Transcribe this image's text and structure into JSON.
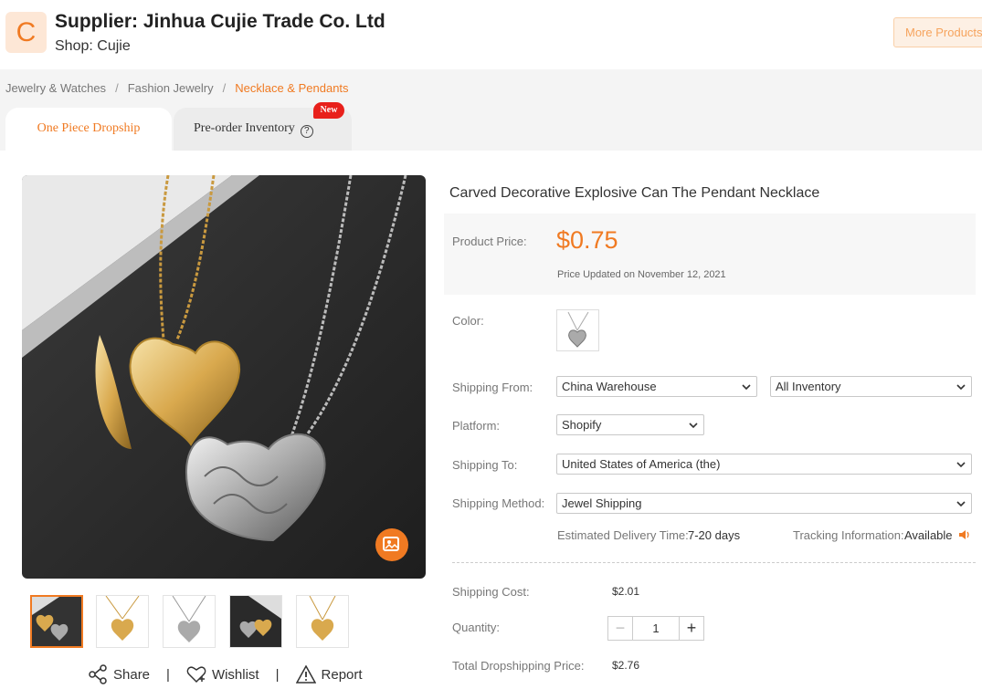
{
  "header": {
    "logo_letter": "C",
    "supplier": "Supplier: Jinhua Cujie Trade Co. Ltd",
    "shop": "Shop: Cujie",
    "more_products": "More Products"
  },
  "breadcrumb": [
    "Jewelry & Watches",
    "Fashion Jewelry",
    "Necklace & Pendants"
  ],
  "tabs": [
    {
      "label": "One Piece Dropship",
      "active": true
    },
    {
      "label": "Pre-order Inventory",
      "badge": "New"
    }
  ],
  "product": {
    "title": "Carved Decorative Explosive Can The Pendant Necklace",
    "price_label": "Product Price:",
    "price": "$0.75",
    "price_updated": "Price Updated on November 12, 2021",
    "color_label": "Color:",
    "shipping_from_label": "Shipping From:",
    "shipping_from": "China Warehouse",
    "inventory": "All Inventory",
    "platform_label": "Platform:",
    "platform": "Shopify",
    "shipping_to_label": "Shipping To:",
    "shipping_to": "United States of America (the)",
    "shipping_method_label": "Shipping Method:",
    "shipping_method": "Jewel Shipping",
    "delivery_label": "Estimated Delivery Time:",
    "delivery_value": "7-20 days",
    "tracking_label": "Tracking Information:",
    "tracking_value": "Available",
    "shipping_cost_label": "Shipping Cost:",
    "shipping_cost": "$2.01",
    "quantity_label": "Quantity:",
    "quantity": "1",
    "total_label": "Total Dropshipping Price:",
    "total": "$2.76"
  },
  "actions": {
    "share": "Share",
    "wishlist": "Wishlist",
    "report": "Report"
  },
  "colors": {
    "accent": "#f07a22",
    "badge": "#e8201b"
  }
}
